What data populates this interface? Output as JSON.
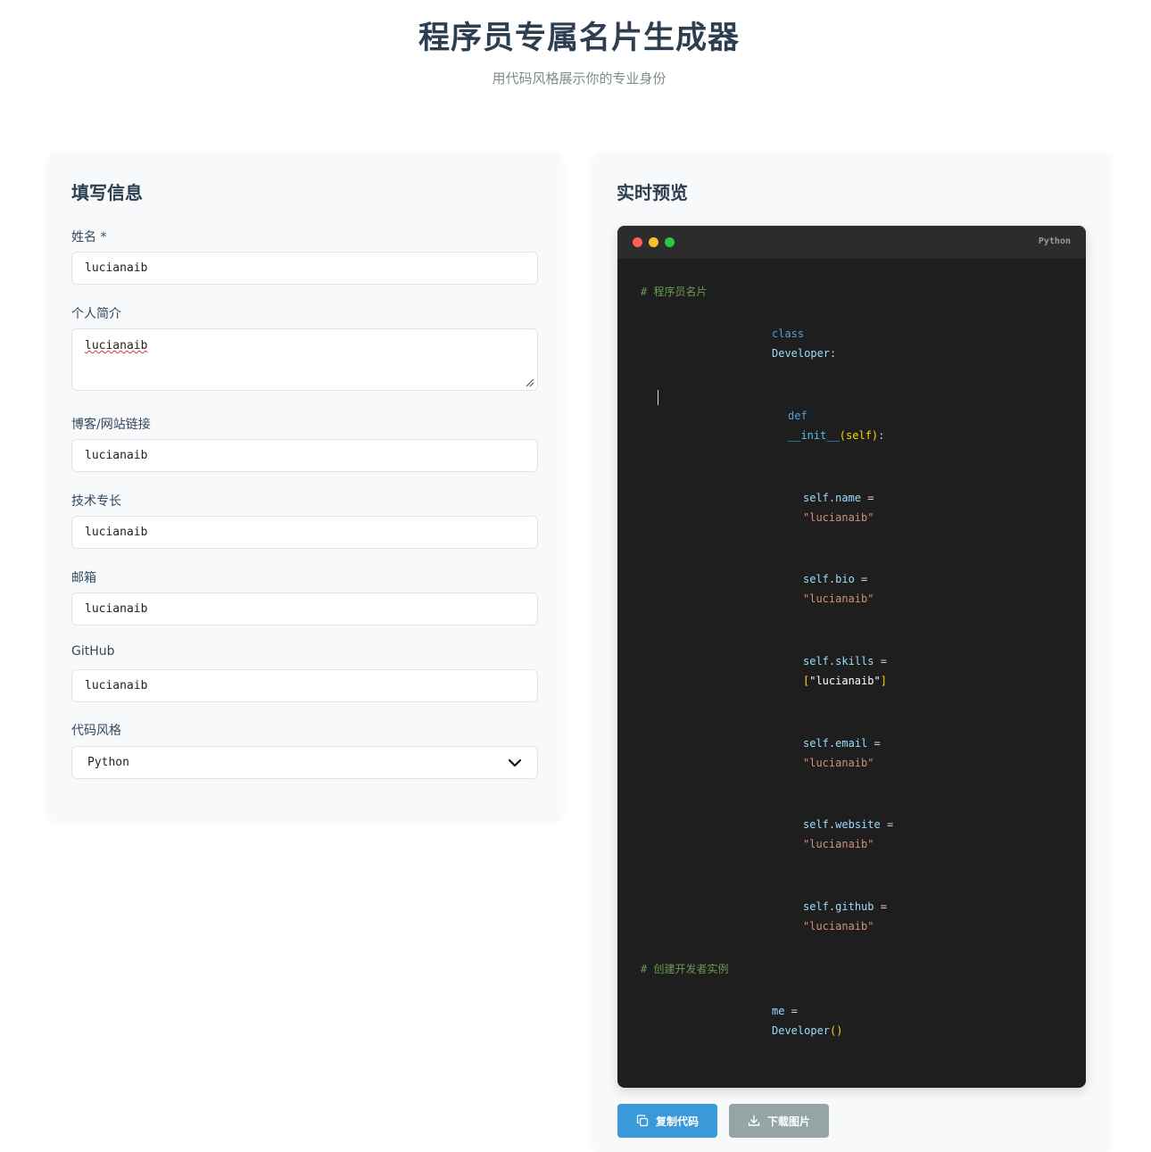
{
  "header": {
    "title": "程序员专属名片生成器",
    "subtitle": "用代码风格展示你的专业身份"
  },
  "form": {
    "title": "填写信息",
    "fields": [
      {
        "label": "姓名 *",
        "value": "lucianaib"
      },
      {
        "label": "个人简介",
        "value": "lucianaib"
      },
      {
        "label": "博客/网站链接",
        "value": "lucianaib"
      },
      {
        "label": "技术专长",
        "value": "lucianaib"
      },
      {
        "label": "邮箱",
        "value": "lucianaib"
      },
      {
        "label": "GitHub",
        "value": "lucianaib"
      }
    ],
    "style": {
      "label": "代码风格",
      "selected": "Python"
    }
  },
  "preview": {
    "title": "实时预览",
    "language_tag": "Python",
    "code": {
      "comment1": "# 程序员名片",
      "kw_class": "class",
      "class_name": "Developer",
      "colon": ":",
      "kw_def": "def",
      "init_fn": "__init__",
      "init_args": "(self)",
      "self": "self",
      "dot": ".",
      "eq": " =",
      "name_prop": "name",
      "bio_prop": "bio",
      "skills_prop": "skills",
      "email_prop": "email",
      "website_prop": "website",
      "github_prop": "github",
      "str_value": "\"lucianaib\"",
      "list_open": "[",
      "list_close": "]",
      "comment2": "# 创建开发者实例",
      "me_var": "me",
      "call_parens": "()"
    }
  },
  "buttons": {
    "copy": "复制代码",
    "download": "下载图片"
  },
  "colors": {
    "copy_button": "#3a9ad9",
    "download_button": "#95a5a6",
    "editor_bg": "#1e1e1e"
  }
}
